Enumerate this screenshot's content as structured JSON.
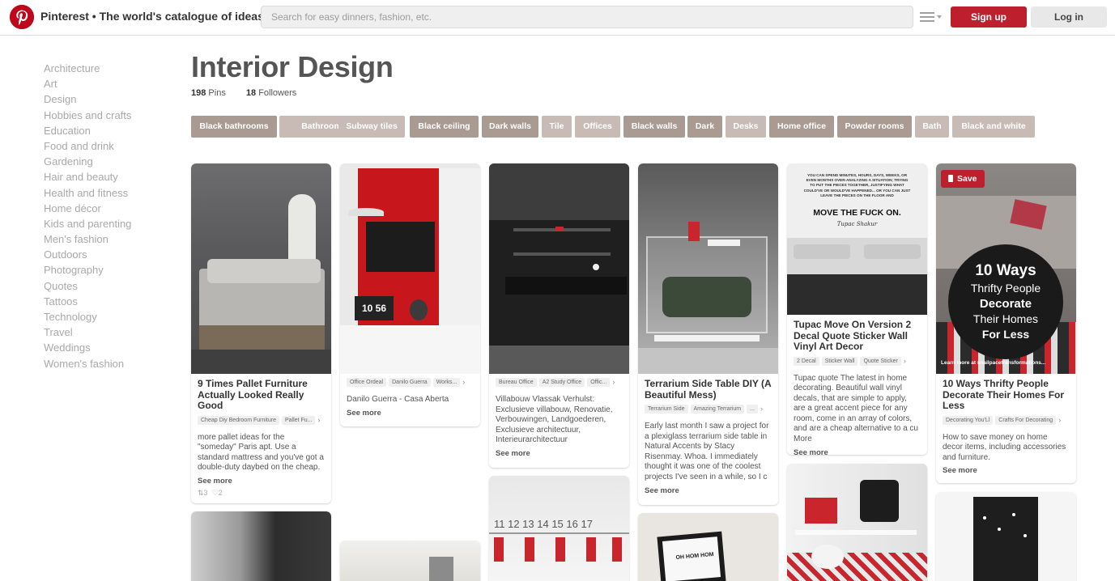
{
  "header": {
    "brand_title": "Pinterest • The world's catalogue of ideas",
    "search_placeholder": "Search for easy dinners, fashion, etc.",
    "signup_label": "Sign up",
    "login_label": "Log in"
  },
  "categories": [
    "Architecture",
    "Art",
    "Design",
    "Hobbies and crafts",
    "Education",
    "Food and drink",
    "Gardening",
    "Hair and beauty",
    "Health and fitness",
    "Home décor",
    "Kids and parenting",
    "Men's fashion",
    "Outdoors",
    "Photography",
    "Quotes",
    "Tattoos",
    "Technology",
    "Travel",
    "Weddings",
    "Women's fashion"
  ],
  "board": {
    "title": "Interior Design",
    "pins_count": "198",
    "pins_label": "Pins",
    "followers_count": "18",
    "followers_label": "Followers"
  },
  "tags": [
    "Black bathrooms",
    "Bathroom",
    "Subway tiles",
    "Black ceiling",
    "Dark walls",
    "Tile",
    "Offices",
    "Black walls",
    "Dark",
    "Desks",
    "Home office",
    "Powder rooms",
    "Bath",
    "Black and white"
  ],
  "pins": {
    "p1": {
      "title": "9 Times Pallet Furniture Actually Looked Really Good",
      "chips": [
        "Cheap Diy Bedroom Furniture",
        "Pallet Fu..."
      ],
      "desc": "more pallet ideas for the \"someday\" Paris apt. Use a standard mattress and you've got a double-duty daybed on the cheap.",
      "see_more": "See more",
      "repins": "3",
      "likes": "2"
    },
    "p2": {
      "chips": [
        "Office Ordeal",
        "Danilo Guerra",
        "Works..."
      ],
      "desc": "Danilo Guerra - Casa Aberta",
      "see_more": "See more",
      "clock": "10 56"
    },
    "p3": {
      "chips": [
        "Bureau Office",
        "A2 Study Office",
        "Offic..."
      ],
      "desc": "Villabouw Vlassak Verhulst: Exclusieve villabouw, Renovatie, Verbouwingen, Landgoederen, Exclusieve architectuur, Interieurarchitectuur",
      "see_more": "See more"
    },
    "p4": {
      "title": "Terrarium Side Table DIY (A Beautiful Mess)",
      "chips": [
        "Terrarium Side",
        "Amazing Terrarium",
        "..."
      ],
      "desc": "Early last month I saw a project for a plexiglass terrarium side table in Natural Accents by Stacy Risenmay. Whoa. I immediately thought it was one of the coolest projects I've seen in a while, so I c",
      "see_more": "See more"
    },
    "p5": {
      "title": "Tupac Move On Version 2 Decal Quote Sticker Wall Vinyl Art Decor",
      "chips": [
        "2 Decal",
        "Sticker Wall",
        "Quote Sticker"
      ],
      "desc": "Tupac quote The latest in home decorating. Beautiful wall vinyl decals, that are simple to apply, are a great accent piece for any room, come in an array of colors, and are a cheap alternative to a cu More",
      "see_more": "See more",
      "poster_small": "YOU CAN SPEND MINUTES, HOURS, DAYS, WEEKS, OR EVEN MONTHS OVER-ANALYZING A SITUATION; TRYING TO PUT THE PIECES TOGETHER, JUSTIFYING WHAT COULD'VE OR WOULD'VE HAPPENED... OR YOU CAN JUST LEAVE THE PIECES ON THE FLOOR AND",
      "poster_big": "MOVE THE FUCK ON.",
      "poster_sig": "Tupac Shakur"
    },
    "p6": {
      "save_label": "Save",
      "overlay_l1": "10 Ways",
      "overlay_l2": "Thrifty People",
      "overlay_l3": "Decorate",
      "overlay_l4": "Their Homes",
      "overlay_l5": "For Less",
      "overlay_small": "Learn more at snailpacetransformations...",
      "title": "10 Ways Thrifty People Decorate Their Homes For Less",
      "chips": [
        "Decorating You'Ll",
        "Crafts For Decorating"
      ],
      "desc": "How to save money on home decor items, including accessories and furniture.",
      "see_more": "See more"
    },
    "p9": {
      "calendar": "11 12 13 14 15 16 17",
      "frame_text": "OH HOM HOM"
    }
  },
  "colors": {
    "brand_red": "#bd081c",
    "signup_red": "#bd1f2d",
    "tag_dark": "#a99a92",
    "tag_light": "#c8bbb5"
  }
}
